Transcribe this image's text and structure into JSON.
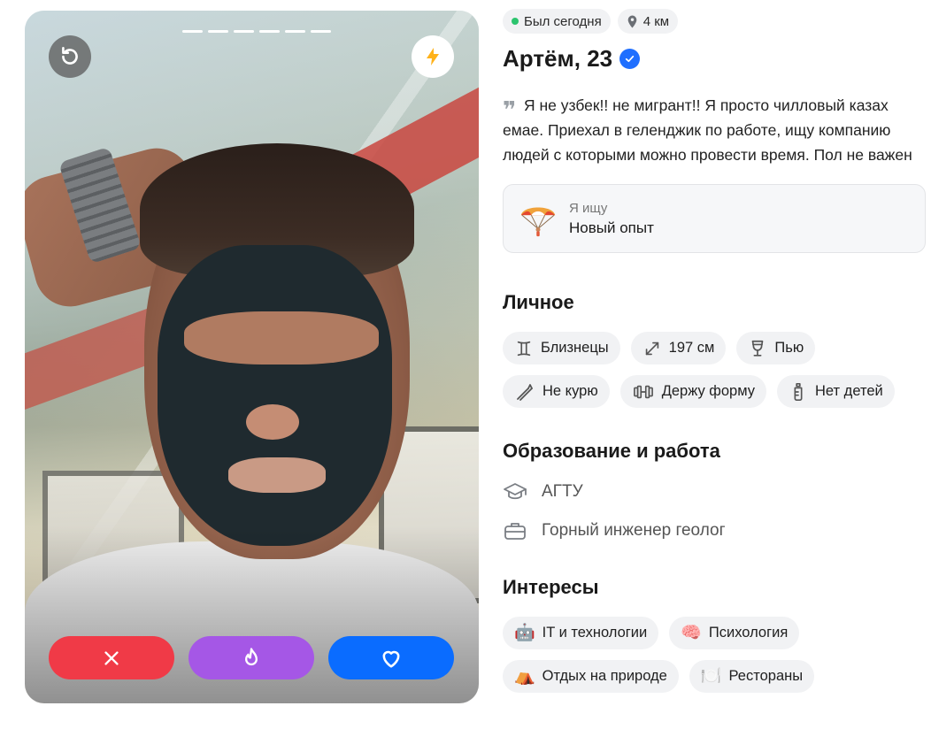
{
  "photo": {
    "progress_segments": 6,
    "undo_icon": "undo-icon",
    "boost_icon": "lightning-icon",
    "actions": [
      {
        "name": "dislike-button",
        "icon": "close-icon",
        "color": "#f03a47"
      },
      {
        "name": "superlike-button",
        "icon": "flame-icon",
        "color": "#a557e6"
      },
      {
        "name": "like-button",
        "icon": "heart-icon",
        "color": "#0a6cff"
      }
    ]
  },
  "status": {
    "online": "Был сегодня",
    "distance": "4 км"
  },
  "profile": {
    "name": "Артём, 23",
    "bio": "Я не узбек!! не мигрант!! Я просто чилловый казах емае. Приехал в геленджик по работе, ищу компанию людей с которыми можно провести время. Пол не важен"
  },
  "seeking": {
    "label": "Я ищу",
    "value": "Новый опыт"
  },
  "personal": {
    "title": "Личное",
    "items": [
      "Близнецы",
      "197 см",
      "Пью",
      "Не курю",
      "Держу форму",
      "Нет детей"
    ]
  },
  "education": {
    "title": "Образование и работа",
    "school": "АГТУ",
    "job": "Горный инженер геолог"
  },
  "interests": {
    "title": "Интересы",
    "items": [
      "IT и технологии",
      "Психология",
      "Отдых на природе",
      "Рестораны"
    ]
  },
  "colors": {
    "accent_blue": "#0a6cff",
    "online_green": "#2cc46e",
    "dislike_red": "#f03a47",
    "super_purple": "#a557e6"
  }
}
